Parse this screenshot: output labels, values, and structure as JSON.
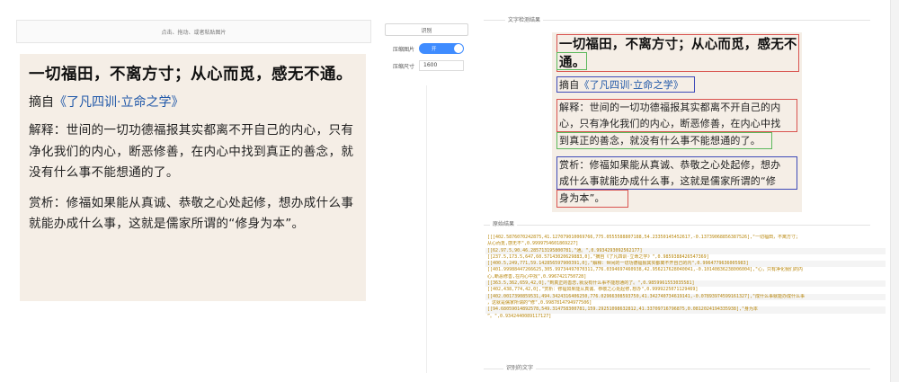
{
  "upload": {
    "hint": "点击、拖动、或者粘贴图片"
  },
  "controls": {
    "recognize_label": "识别",
    "compress_label": "压缩图片",
    "compress_toggle": "开",
    "size_label": "压缩尺寸",
    "size_value": "1600"
  },
  "image_text": {
    "title": "一切福田，不离方寸；从心而觅，感无不通。",
    "source_prefix": "摘自",
    "source_book": "《了凡四训·立命之学》",
    "explain": "解释：世间的一切功德福报其实都离不开自己的内心，只有净化我们的内心，断恶修善，在内心中找到真正的善念，就没有什么事不能想通的了。",
    "appreciate": "赏析：修福如果能从真诚、恭敬之心处起修，想办成什么事就能办成什么事，这就是儒家所谓的“修身为本”。"
  },
  "result": {
    "section_title": "文字检测结果",
    "title_line1": "一切福田，不离方寸；从心而觅，感无不",
    "title_line2": "通。",
    "source_prefix": "摘自",
    "source_book": "《了凡四训·立命之学》",
    "explain_line1": "解释：世间的一切功德福报其实都离不开自己的内",
    "explain_line2": "心，只有净化我们的内心，断恶修善，在内心中找",
    "explain_line3": "到真正的善念，就没有什么事不能想通的了。",
    "app_line1": "赏析：修福如果能从真诚、恭敬之心处起修，想办",
    "app_line2": "成什么事就能办成什么事，这就是儒家所谓的“修",
    "app_line3": "身为本”。"
  },
  "raw": {
    "section_title": "原始结果",
    "lines": [
      "[[[402.5876070242875,41.127079010069766,775.0555588807188,54.23350145452617,-0.13739068856387526],\"一切福田，不离方寸；",
      "从心而觅,感无不\",0.9999754601869227]",
      "[[62.97.5,90.46.285713195800781,\"通。\",0.9934293092562177]",
      "[[237.5,173.5,647,60.57143020629883,0],\"摘自《了凡四训·立命之学》\",0.9859388426547369]",
      "[[400.5,249,771,59.142856597900391,0],\"解释：世间的一切功德福报其实都离不开自己的内\",0.9964779636005983]",
      "[[401.99988447266625,305.99734497070311,776.0394697460938,42.956217628040041,-0.10140836238006004],\"心，只有净化我们的内",
      "心,断恶修善,在内心中找\",0.9967421750728]",
      "[[363.5,362,659,42,0],\"到真正的善念,就没有什么事不能想通的了。\",0.9859961553035581]",
      "[[402,438,774,42,0],\"赏析：修福如果能从真诚、恭敬之心处起修,想办\",0.9999225071129469]",
      "[[402.0017390859531,494.3424316406250,776.02966308593750,41.342740734619141,-0.07893974599161327],\"成什么事就能办成什么事",
      "，这就是儒家所谓的“修\",0.9987814794977506]",
      "[[94.68059014892578,549.314758300781,159.29251098632812,41.33709716796875,0.0812024194335938],\"身为本",
      "”。\",0.9342440089117127]"
    ]
  },
  "corrected": {
    "section_title": "识别的文字"
  }
}
